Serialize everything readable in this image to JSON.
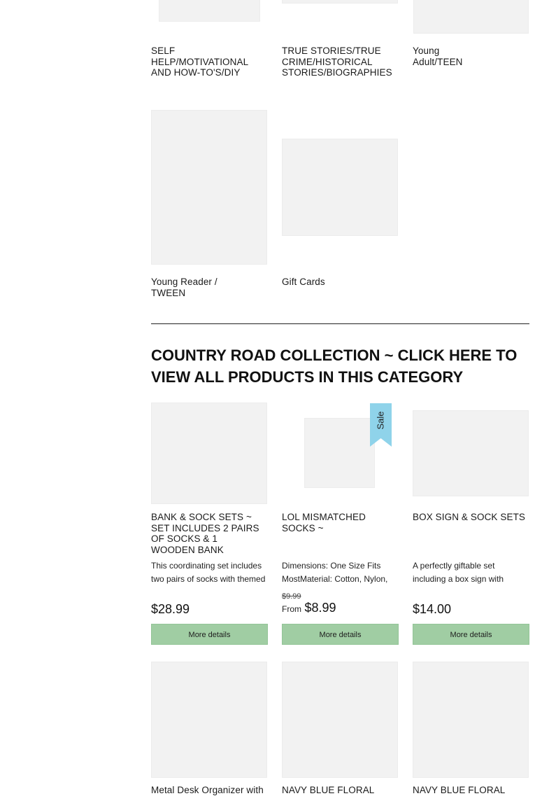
{
  "collections_top": [
    {
      "title": "SELF HELP/MOTIVATIONAL AND HOW-TO'S/DIY"
    },
    {
      "title": "TRUE STORIES/TRUE CRIME/HISTORICAL STORIES/BIOGRAPHIES"
    },
    {
      "title": "Young Adult/TEEN"
    },
    {
      "title": "Young Reader / TWEEN"
    },
    {
      "title": "Gift Cards"
    }
  ],
  "section": {
    "heading": "COUNTRY ROAD COLLECTION ~ CLICK HERE TO VIEW ALL PRODUCTS IN THIS CATEGORY"
  },
  "products": [
    {
      "title": "BANK & SOCK SETS ~ SET INCLUDES 2 PAIRS OF SOCKS & 1 WOODEN BANK",
      "description": "This coordinating set includes two pairs of socks with themed",
      "price": "$28.99",
      "button": "More details"
    },
    {
      "title": "LOL MISMATCHED SOCKS ~",
      "description": "Dimensions: One Size Fits MostMaterial: Cotton, Nylon,",
      "compare_price": "$9.99",
      "price_prefix": "From",
      "price": "$8.99",
      "badge": "Sale",
      "button": "More details"
    },
    {
      "title": "BOX SIGN & SOCK SETS",
      "description": "A perfectly giftable set including a box sign with",
      "price": "$14.00",
      "button": "More details"
    }
  ],
  "products_bottom": [
    {
      "title": "Metal Desk Organizer with"
    },
    {
      "title": "NAVY BLUE FLORAL"
    },
    {
      "title": "NAVY BLUE FLORAL"
    }
  ],
  "colors": {
    "button_bg": "#a0cda3",
    "sale_badge": "#8fd3ea",
    "placeholder": "#f2f2f2"
  }
}
